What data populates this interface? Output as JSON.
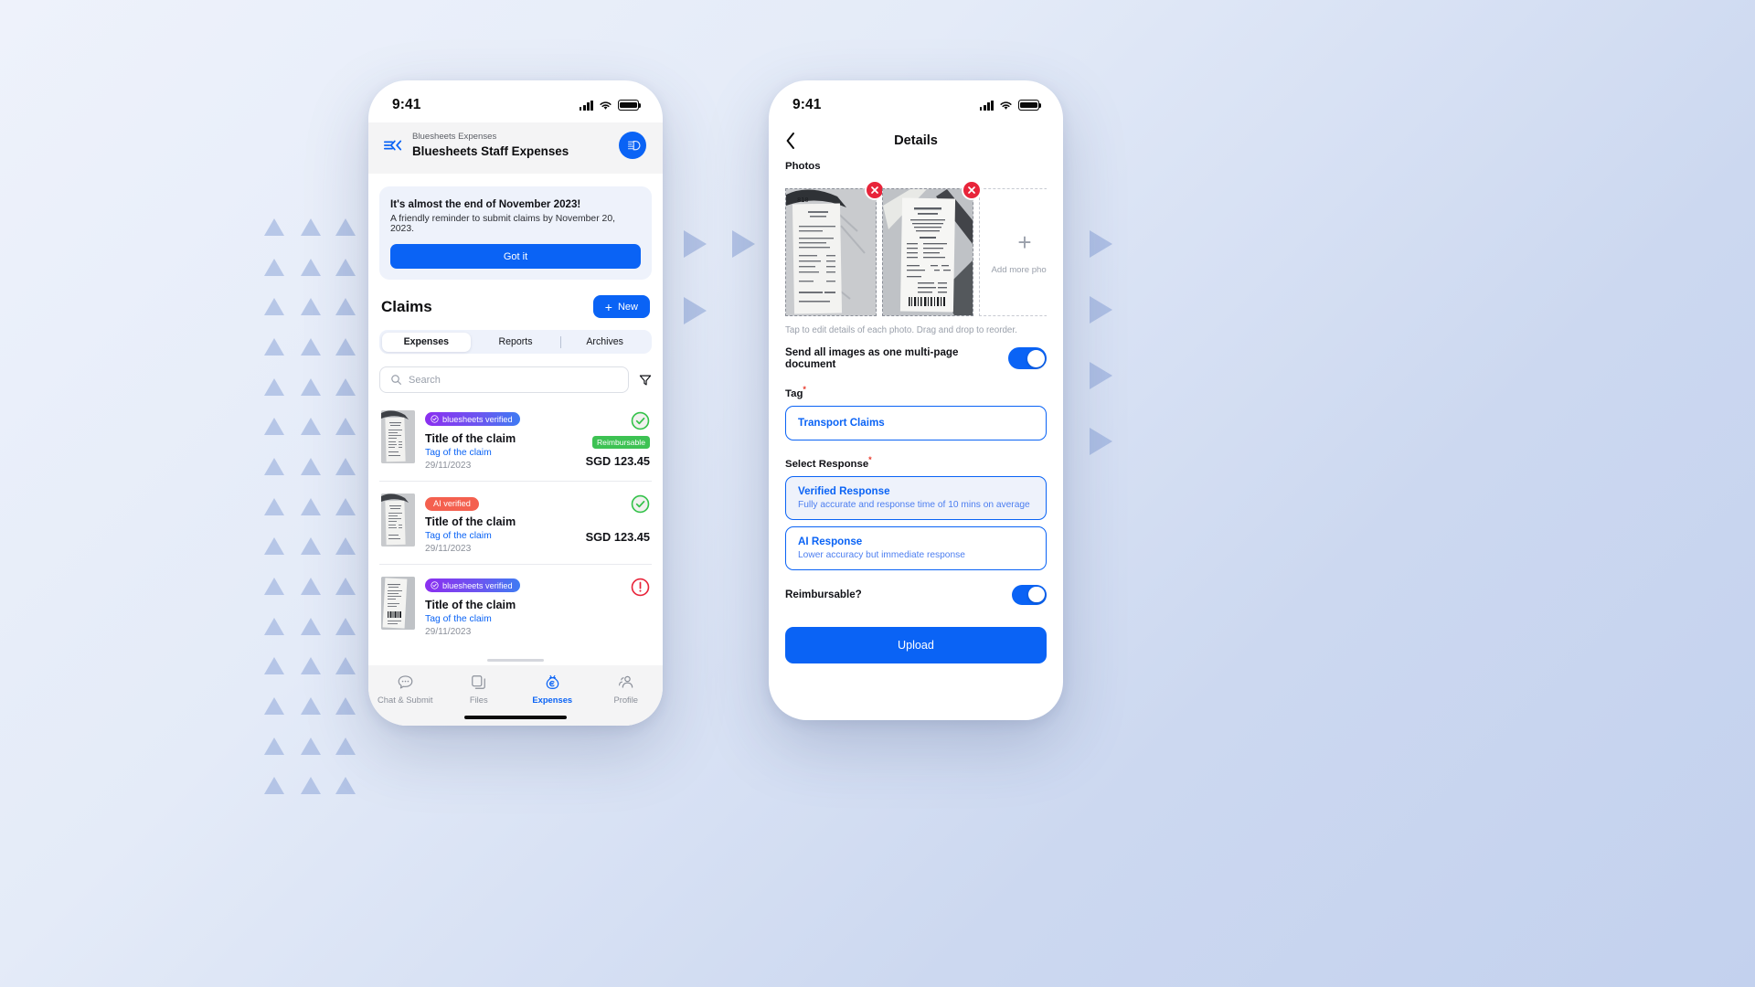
{
  "left_phone": {
    "statusbar": {
      "time": "9:41",
      "signal_icon": "cellular-bars-icon",
      "wifi_icon": "wifi-icon",
      "battery_icon": "battery-full-icon"
    },
    "header": {
      "logo_icon": "bluesheets-arrows-logo-icon",
      "org_name": "Bluesheets Expenses",
      "workspace_title": "Bluesheets Staff Expenses",
      "avatar_icon": "bluesheets-avatar-icon"
    },
    "banner": {
      "title": "It's almost the end of November 2023!",
      "subtitle": "A friendly reminder to submit claims by November 20, 2023.",
      "button_label": "Got it"
    },
    "claims_section": {
      "heading": "Claims",
      "new_button_label": "New",
      "new_button_icon": "plus-icon",
      "tabs": [
        {
          "label": "Expenses",
          "active": true
        },
        {
          "label": "Reports",
          "active": false
        },
        {
          "label": "Archives",
          "active": false
        }
      ],
      "search": {
        "placeholder": "Search",
        "value": "",
        "icon": "search-icon"
      },
      "filter_icon": "filter-funnel-icon"
    },
    "claims": [
      {
        "badge_label": "bluesheets verified",
        "badge_type": "bluesheets",
        "badge_icon": "check-circle-icon",
        "title": "Title of the claim",
        "tag": "Tag of the claim",
        "date": "29/11/2023",
        "status_icon": "check-circle-green-icon",
        "reimbursable_label": "Reimbursable",
        "amount": "SGD 123.45"
      },
      {
        "badge_label": "AI verified",
        "badge_type": "ai",
        "badge_icon": "",
        "title": "Title of the claim",
        "tag": "Tag of the claim",
        "date": "29/11/2023",
        "status_icon": "check-circle-green-icon",
        "reimbursable_label": "",
        "amount": "SGD 123.45"
      },
      {
        "badge_label": "bluesheets verified",
        "badge_type": "bluesheets",
        "badge_icon": "check-circle-icon",
        "title": "Title of the claim",
        "tag": "Tag of the claim",
        "date": "29/11/2023",
        "status_icon": "alert-circle-red-icon",
        "reimbursable_label": "",
        "amount": ""
      }
    ],
    "tabbar": [
      {
        "label": "Chat & Submit",
        "icon": "chat-bubble-icon",
        "active": false
      },
      {
        "label": "Files",
        "icon": "files-stack-icon",
        "active": false
      },
      {
        "label": "Expenses",
        "icon": "money-bag-euro-icon",
        "active": true
      },
      {
        "label": "Profile",
        "icon": "users-profile-icon",
        "active": false
      }
    ]
  },
  "right_phone": {
    "statusbar": {
      "time": "9:41",
      "signal_icon": "cellular-bars-icon",
      "wifi_icon": "wifi-icon",
      "battery_icon": "battery-full-icon"
    },
    "nav": {
      "back_icon": "chevron-left-icon",
      "title": "Details"
    },
    "photos": {
      "label": "Photos",
      "items": [
        {
          "delete_icon": "close-x-icon",
          "alt": "receipt-photo-1"
        },
        {
          "delete_icon": "close-x-icon",
          "alt": "receipt-photo-2"
        }
      ],
      "add_more_label": "Add more photos",
      "add_more_icon": "plus-icon",
      "hint": "Tap to edit details of each photo. Drag and drop to reorder."
    },
    "multipage_toggle": {
      "label": "Send all images as one multi-page document",
      "state": "on"
    },
    "tag_field": {
      "label": "Tag",
      "required_marker": "*",
      "value": "Transport Claims"
    },
    "select_response": {
      "label": "Select Response",
      "required_marker": "*",
      "options": [
        {
          "title": "Verified Response",
          "description": "Fully accurate and response time of 10 mins on average",
          "selected": true
        },
        {
          "title": "AI Response",
          "description": "Lower accuracy but immediate response",
          "selected": false
        }
      ]
    },
    "reimbursable_toggle": {
      "label": "Reimbursable?",
      "state": "on"
    },
    "upload_button_label": "Upload"
  },
  "colors": {
    "brand_blue": "#0a63f5",
    "success_green": "#3dc253",
    "danger_red": "#e8243a",
    "ai_coral": "#f4604f",
    "badge_purple": "#8b2ff0"
  }
}
